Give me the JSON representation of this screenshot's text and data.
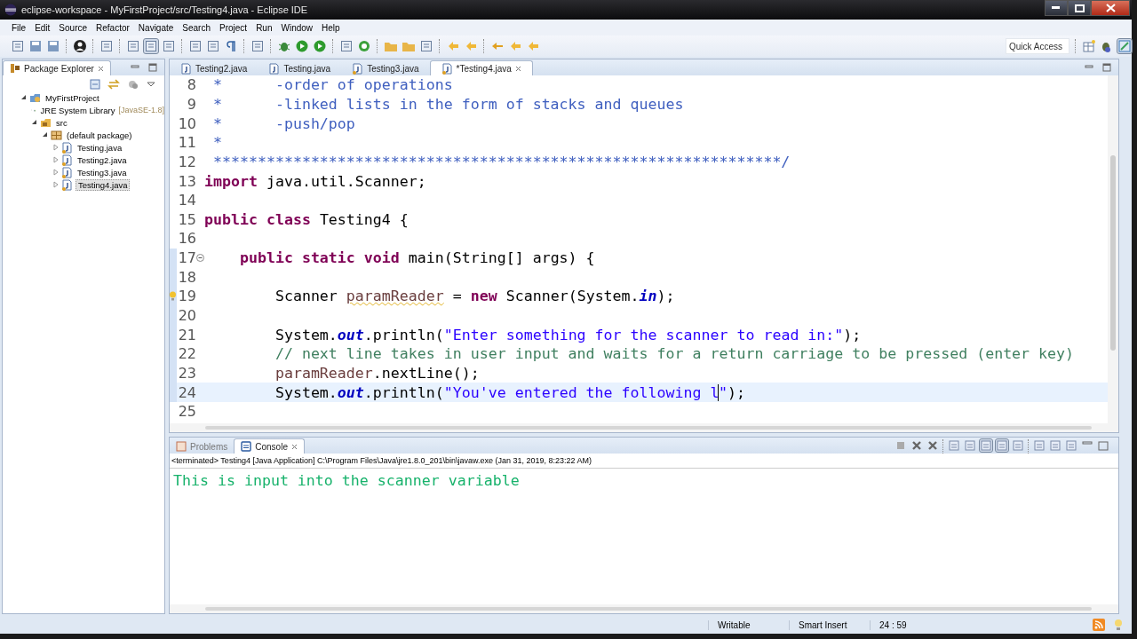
{
  "window": {
    "title": "eclipse-workspace - MyFirstProject/src/Testing4.java - Eclipse IDE"
  },
  "menu": [
    "File",
    "Edit",
    "Source",
    "Refactor",
    "Navigate",
    "Search",
    "Project",
    "Run",
    "Window",
    "Help"
  ],
  "quick_access": {
    "placeholder": "Quick Access"
  },
  "package_explorer": {
    "title": "Package Explorer",
    "tree": [
      {
        "label": "MyFirstProject",
        "kind": "project",
        "expanded": true,
        "selected": false,
        "children": [
          {
            "label": "JRE System Library",
            "decoration": "[JavaSE-1.8]",
            "kind": "library",
            "expanded": false,
            "selected": false
          },
          {
            "label": "src",
            "kind": "source",
            "expanded": true,
            "selected": false,
            "children": [
              {
                "label": "(default package)",
                "kind": "package",
                "expanded": true,
                "selected": false,
                "children": [
                  {
                    "label": "Testing.java",
                    "kind": "file",
                    "expanded": false,
                    "selected": false
                  },
                  {
                    "label": "Testing2.java",
                    "kind": "file",
                    "expanded": false,
                    "selected": false
                  },
                  {
                    "label": "Testing3.java",
                    "kind": "file",
                    "expanded": false,
                    "selected": false
                  },
                  {
                    "label": "Testing4.java",
                    "kind": "file",
                    "expanded": false,
                    "selected": true
                  }
                ]
              }
            ]
          }
        ]
      }
    ]
  },
  "editor": {
    "tabs": [
      {
        "label": "Testing2.java",
        "selected": false,
        "warning": false
      },
      {
        "label": "Testing.java",
        "selected": false,
        "warning": false
      },
      {
        "label": "Testing3.java",
        "selected": false,
        "warning": true
      },
      {
        "label": "*Testing4.java",
        "selected": true,
        "warning": true
      }
    ],
    "lines": [
      {
        "number": "8",
        "segments": [
          {
            "kind": "javadoc",
            "text": " *      -order of operations"
          }
        ]
      },
      {
        "number": "9",
        "segments": [
          {
            "kind": "javadoc",
            "text": " *      -linked lists in the form of stacks and queues"
          }
        ]
      },
      {
        "number": "10",
        "segments": [
          {
            "kind": "javadoc",
            "text": " *      -push/pop"
          }
        ]
      },
      {
        "number": "11",
        "segments": [
          {
            "kind": "javadoc",
            "text": " *"
          }
        ]
      },
      {
        "number": "12",
        "segments": [
          {
            "kind": "javadoc",
            "text": " ****************************************************************/"
          }
        ]
      },
      {
        "number": "13",
        "segments": [
          {
            "kind": "keyword",
            "text": "import"
          },
          {
            "kind": "plain",
            "text": " java.util.Scanner;"
          }
        ]
      },
      {
        "number": "14"
      },
      {
        "number": "15",
        "segments": [
          {
            "kind": "keyword",
            "text": "public class"
          },
          {
            "kind": "plain",
            "text": " Testing4 {"
          }
        ]
      },
      {
        "number": "16"
      },
      {
        "number": "17",
        "fold_expanded": true,
        "range": true,
        "segments": [
          {
            "kind": "keyword",
            "text": "    public static void"
          },
          {
            "kind": "plain",
            "text": " main(String[] args) {"
          }
        ]
      },
      {
        "number": "18",
        "range": true
      },
      {
        "number": "19",
        "warning": true,
        "range": true,
        "segments": [
          {
            "kind": "plain",
            "text": "        Scanner "
          },
          {
            "kind": "variable",
            "text": "paramReader",
            "warning": true
          },
          {
            "kind": "plain",
            "text": " = "
          },
          {
            "kind": "keyword",
            "text": "new"
          },
          {
            "kind": "plain",
            "text": " Scanner(System."
          },
          {
            "kind": "field",
            "text": "in"
          },
          {
            "kind": "plain",
            "text": ");"
          }
        ]
      },
      {
        "number": "20",
        "range": true
      },
      {
        "number": "21",
        "range": true,
        "segments": [
          {
            "kind": "plain",
            "text": "        System."
          },
          {
            "kind": "field",
            "text": "out"
          },
          {
            "kind": "plain",
            "text": ".println("
          },
          {
            "kind": "string",
            "text": "\"Enter something for the scanner to read in:\""
          },
          {
            "kind": "plain",
            "text": ");"
          }
        ]
      },
      {
        "number": "22",
        "range": true,
        "segments": [
          {
            "kind": "comment",
            "text": "        // next line takes in user input and waits for a return carriage to be pressed (enter key)"
          }
        ]
      },
      {
        "number": "23",
        "range": true,
        "segments": [
          {
            "kind": "variable",
            "text": "        paramReader"
          },
          {
            "kind": "plain",
            "text": ".nextLine();"
          }
        ]
      },
      {
        "number": "24",
        "range": true,
        "current": true,
        "segments": [
          {
            "kind": "plain",
            "text": "        System."
          },
          {
            "kind": "field",
            "text": "out"
          },
          {
            "kind": "plain",
            "text": ".println("
          },
          {
            "kind": "string",
            "text": "\"You've entered the following l"
          },
          {
            "kind": "string",
            "text": "\"",
            "cursor_before": true
          },
          {
            "kind": "plain",
            "text": ");"
          }
        ]
      },
      {
        "number": "25"
      }
    ]
  },
  "console": {
    "tabs": [
      {
        "label": "Problems",
        "selected": false
      },
      {
        "label": "Console",
        "selected": true
      }
    ],
    "header": "<terminated> Testing4 [Java Application] C:\\Program Files\\Java\\jre1.8.0_201\\bin\\javaw.exe (Jan 31, 2019, 8:23:22 AM)",
    "output": "This is input into the scanner variable"
  },
  "status_bar": [
    "Writable",
    "Smart Insert",
    "24 : 59"
  ]
}
